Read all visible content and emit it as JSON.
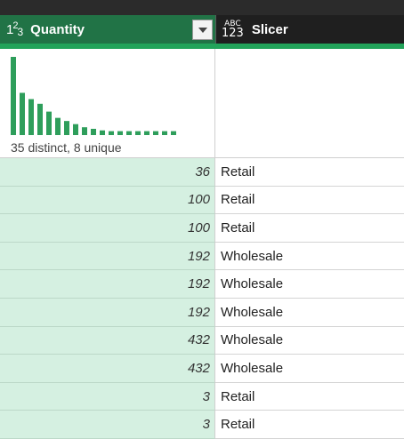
{
  "columns": [
    {
      "type_icon": "number-type-icon",
      "type_text": "123",
      "name": "Quantity"
    },
    {
      "type_icon": "any-type-icon",
      "type_text_top": "ABC",
      "type_text_bottom": "123",
      "name": "Slicer"
    }
  ],
  "profile": {
    "summary": "35 distinct, 8 unique",
    "histogram": [
      1.0,
      0.54,
      0.46,
      0.4,
      0.3,
      0.22,
      0.18,
      0.14,
      0.1,
      0.08,
      0.06,
      0.05,
      0.05,
      0.05,
      0.05,
      0.05,
      0.05,
      0.05,
      0.05
    ]
  },
  "rows": [
    {
      "quantity": "36",
      "slicer": "Retail"
    },
    {
      "quantity": "100",
      "slicer": "Retail"
    },
    {
      "quantity": "100",
      "slicer": "Retail"
    },
    {
      "quantity": "192",
      "slicer": "Wholesale"
    },
    {
      "quantity": "192",
      "slicer": "Wholesale"
    },
    {
      "quantity": "192",
      "slicer": "Wholesale"
    },
    {
      "quantity": "432",
      "slicer": "Wholesale"
    },
    {
      "quantity": "432",
      "slicer": "Wholesale"
    },
    {
      "quantity": "3",
      "slicer": "Retail"
    },
    {
      "quantity": "3",
      "slicer": "Retail"
    }
  ],
  "colors": {
    "header_green": "#217346",
    "bar_green": "#2e9e5b",
    "cell_green": "#d5f0e1"
  }
}
